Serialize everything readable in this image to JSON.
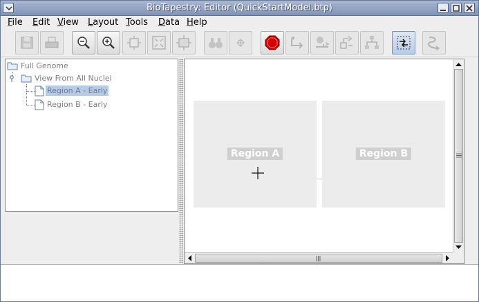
{
  "window": {
    "title": "BioTapestry: Editor (QuickStartModel.btp)"
  },
  "menubar": {
    "items": [
      {
        "label": "File",
        "mnemonic": "F",
        "rest": "ile"
      },
      {
        "label": "Edit",
        "mnemonic": "E",
        "rest": "dit"
      },
      {
        "label": "View",
        "mnemonic": "V",
        "rest": "iew"
      },
      {
        "label": "Layout",
        "mnemonic": "L",
        "rest": "ayout"
      },
      {
        "label": "Tools",
        "mnemonic": "T",
        "rest": "ools"
      },
      {
        "label": "Data",
        "mnemonic": "D",
        "rest": "ata"
      },
      {
        "label": "Help",
        "mnemonic": "H",
        "rest": "elp"
      }
    ]
  },
  "toolbar": {
    "buttons": [
      {
        "name": "save",
        "icon": "floppy-disk-icon",
        "state": "disabled"
      },
      {
        "name": "print",
        "icon": "printer-icon",
        "state": "disabled"
      },
      {
        "name": "zoom-out",
        "icon": "zoom-out-icon",
        "state": "enabled"
      },
      {
        "name": "zoom-in",
        "icon": "zoom-in-icon",
        "state": "enabled"
      },
      {
        "name": "zoom-to-model",
        "icon": "zoom-to-model-icon",
        "state": "disabled"
      },
      {
        "name": "zoom-to-all",
        "icon": "zoom-to-all-icon",
        "state": "disabled"
      },
      {
        "name": "zoom-to-selection",
        "icon": "zoom-to-selection-icon",
        "state": "disabled"
      },
      {
        "name": "search",
        "icon": "binoculars-icon",
        "state": "disabled"
      },
      {
        "name": "center",
        "icon": "crosshair-icon",
        "state": "disabled"
      },
      {
        "name": "cancel",
        "icon": "stop-sign-icon",
        "state": "enabled"
      },
      {
        "name": "add-link",
        "icon": "add-link-icon",
        "state": "disabled"
      },
      {
        "name": "add-gene",
        "icon": "add-gene-icon",
        "state": "disabled"
      },
      {
        "name": "add-node",
        "icon": "add-node-icon",
        "state": "disabled"
      },
      {
        "name": "layout-tree",
        "icon": "tree-layout-icon",
        "state": "disabled"
      },
      {
        "name": "select-mode",
        "icon": "select-mode-icon",
        "state": "active"
      },
      {
        "name": "relink",
        "icon": "squiggle-icon",
        "state": "disabled"
      }
    ]
  },
  "tree": {
    "nodes": [
      {
        "label": "Full Genome",
        "icon": "folder-icon",
        "selected": false
      },
      {
        "label": "View From All Nuclei",
        "icon": "folder-icon",
        "selected": false
      },
      {
        "label": "Region A - Early",
        "icon": "document-icon",
        "selected": true
      },
      {
        "label": "Region B - Early",
        "icon": "document-icon",
        "selected": false
      }
    ]
  },
  "canvas": {
    "regions": [
      {
        "label": "Region A"
      },
      {
        "label": "Region B"
      }
    ],
    "colors": {
      "region_fill": "#ececec",
      "region_label_bg": "#cfcfcf",
      "region_label_text": "#ffffff"
    }
  },
  "scroll": {
    "vertical_position": 0.5,
    "horizontal_position": 0.5
  }
}
